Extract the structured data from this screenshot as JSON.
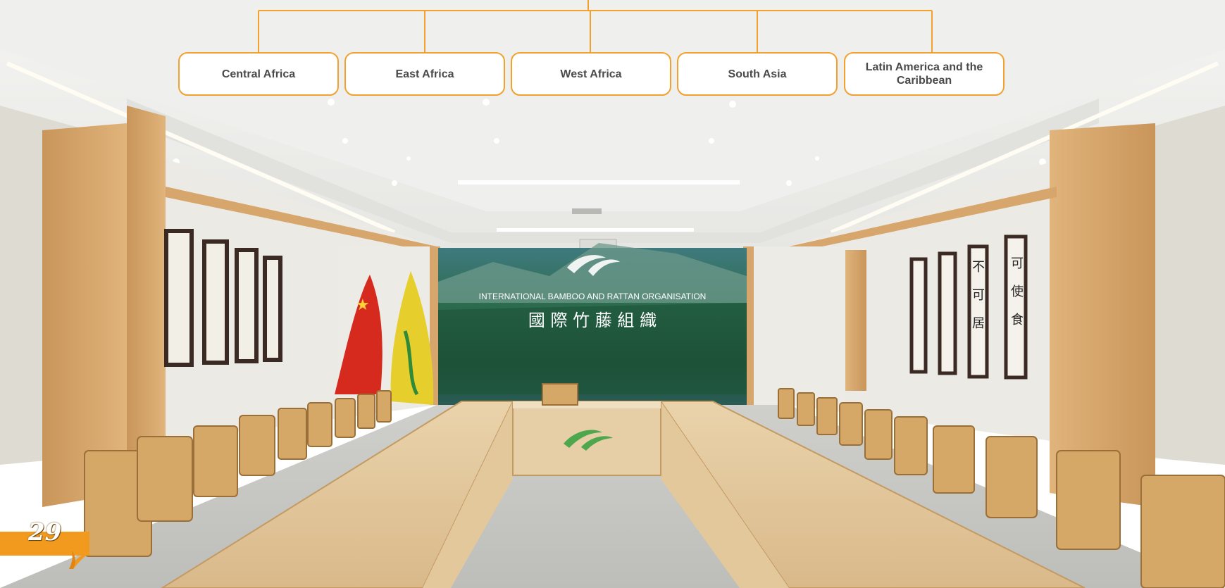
{
  "org_chart": {
    "regions": [
      {
        "label": "Central Africa"
      },
      {
        "label": "East Africa"
      },
      {
        "label": "West Africa"
      },
      {
        "label": "South Asia"
      },
      {
        "label": "Latin America and the Caribbean"
      }
    ],
    "line_color": "#f2a12e"
  },
  "photo": {
    "backdrop_heading": "INTERNATIONAL BAMBOO AND RATTAN ORGANISATION",
    "backdrop_chinese": "國 際 竹 藤 組 織"
  },
  "page": {
    "number": "29",
    "accent_color": "#f29a1e"
  }
}
